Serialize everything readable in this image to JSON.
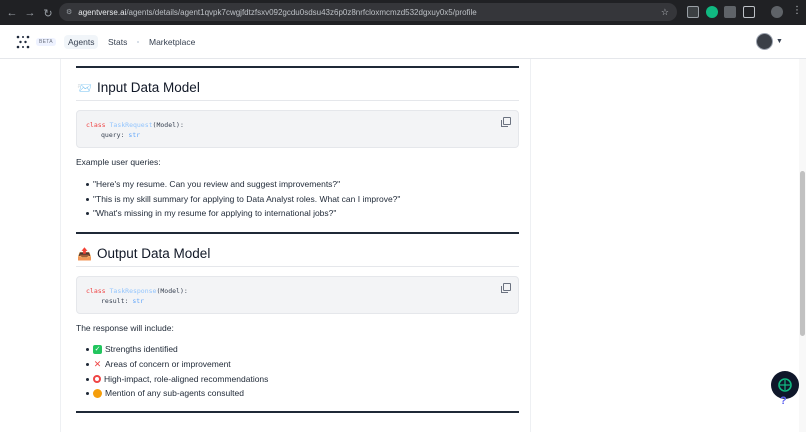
{
  "browser": {
    "url_domain": "agentverse.ai",
    "url_path": "/agents/details/agent1qvpk7cwgjfdtzfsxv092gcdu0sdsu43z6p0z8nrfcloxmcmzd532dgxuy0x5/profile",
    "back_icon": "arrow-left-icon",
    "forward_icon": "arrow-right-icon",
    "reload_icon": "reload-icon"
  },
  "header": {
    "beta_label": "BETA",
    "nav": [
      "Agents",
      "Stats",
      "Marketplace"
    ],
    "active_nav": "Agents"
  },
  "input_section": {
    "icon": "📨",
    "title": "Input Data Model",
    "code_class": "TaskRequest",
    "code_base": "(Model):",
    "code_field": "query:",
    "code_type": "str",
    "queries_label": "Example user queries:",
    "queries": [
      "\"Here's my resume. Can you review and suggest improvements?\"",
      "\"This is my skill summary for applying to Data Analyst roles. What can I improve?\"",
      "\"What's missing in my resume for applying to international jobs?\""
    ]
  },
  "output_section": {
    "icon": "📤",
    "title": "Output Data Model",
    "code_class": "TaskResponse",
    "code_base": "(Model):",
    "code_field": "result:",
    "code_type": "str",
    "response_label": "The response will include:",
    "items": [
      {
        "emoji": "✅",
        "text": "Strengths identified",
        "color": "#22c55e"
      },
      {
        "emoji": "❌",
        "text": "Areas of concern or improvement",
        "color": "#ef4444"
      },
      {
        "emoji": "🎯",
        "text": "High-impact, role-aligned recommendations",
        "color": "#ef4444"
      },
      {
        "emoji": "🤝",
        "text": "Mention of any sub-agents consulted",
        "color": "#f59e0b"
      }
    ]
  },
  "code_keyword": "class"
}
